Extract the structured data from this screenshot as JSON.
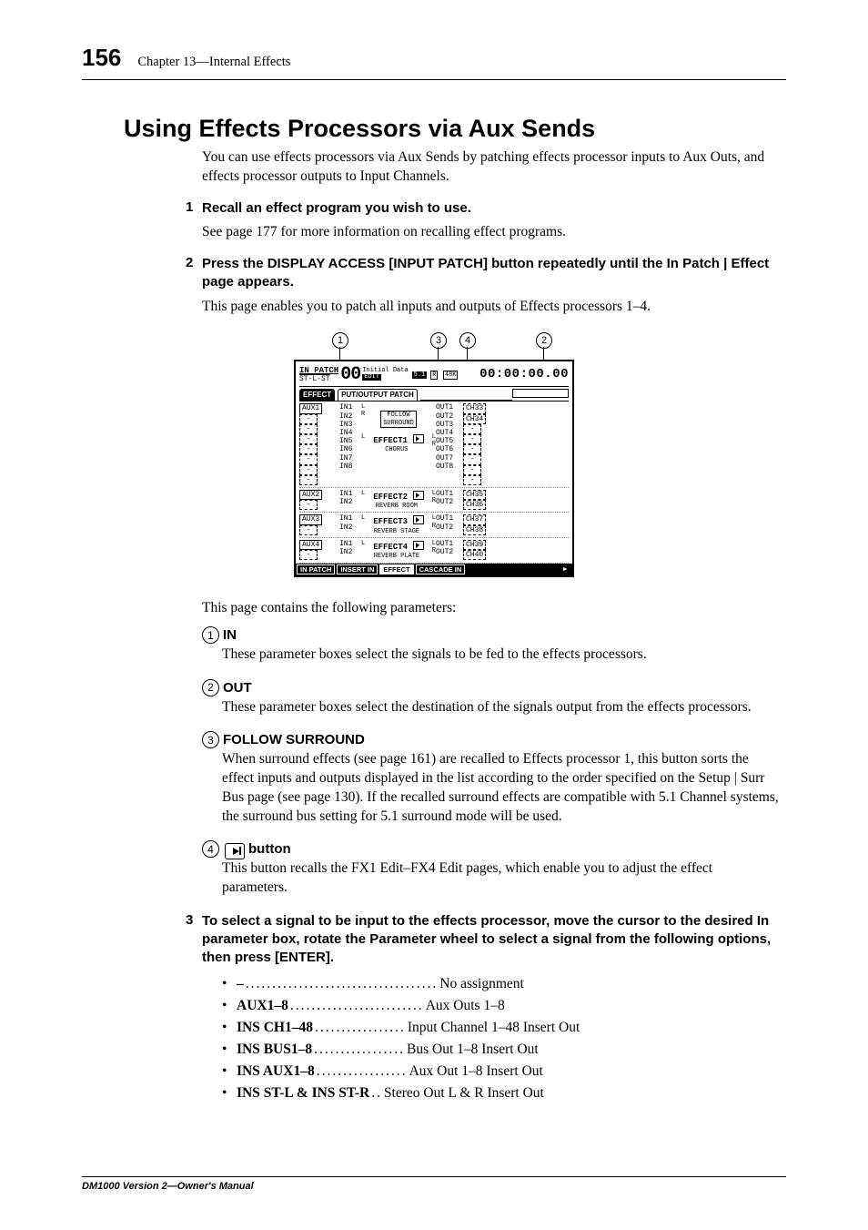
{
  "page_number": "156",
  "chapter_label": "Chapter 13—Internal Effects",
  "section_title": "Using Effects Processors via Aux Sends",
  "intro": "You can use effects processors via Aux Sends by patching effects processor inputs to Aux Outs, and effects processor outputs to Input Channels.",
  "steps": [
    {
      "num": "1",
      "head": "Recall an effect program you wish to use.",
      "body": "See page 177 for more information on recalling effect programs."
    },
    {
      "num": "2",
      "head": "Press the DISPLAY ACCESS [INPUT PATCH] button repeatedly until the In Patch | Effect page appears.",
      "body": "This page enables you to patch all inputs and outputs of Effects processors 1–4."
    }
  ],
  "post_figure_intro": "This page contains the following parameters:",
  "params": [
    {
      "num": "1",
      "label": "IN",
      "desc": "These parameter boxes select the signals to be fed to the effects processors."
    },
    {
      "num": "2",
      "label": "OUT",
      "desc": "These parameter boxes select the destination of the signals output from the effects processors."
    },
    {
      "num": "3",
      "label": "FOLLOW SURROUND",
      "desc": "When surround effects (see page 161) are recalled to Effects processor 1, this button sorts the effect inputs and outputs displayed in the list according to the order specified on the Setup | Surr Bus page (see page 130). If the recalled surround effects are compatible with 5.1 Channel systems, the surround bus setting for 5.1 surround mode will be used."
    },
    {
      "num": "4",
      "label_icon": true,
      "label": "button",
      "desc": "This button recalls the FX1 Edit–FX4 Edit pages, which enable you to adjust the effect parameters."
    }
  ],
  "step3": {
    "num": "3",
    "head": "To select a signal to be input to the effects processor, move the cursor to the desired In parameter box, rotate the Parameter wheel to select a signal from the following options, then press [ENTER]."
  },
  "bullets": [
    {
      "key": "–",
      "dots": "....................................",
      "val": "No assignment"
    },
    {
      "key": "AUX1–8",
      "dots": ".........................",
      "val": "Aux Outs 1–8"
    },
    {
      "key": "INS CH1–48",
      "dots": ".................",
      "val": "Input Channel 1–48 Insert Out"
    },
    {
      "key": "INS BUS1–8",
      "dots": ".................",
      "val": "Bus Out 1–8 Insert Out"
    },
    {
      "key": "INS AUX1–8",
      "dots": ".................",
      "val": "Aux Out 1–8 Insert Out"
    },
    {
      "key": "INS ST-L & INS ST-R",
      "dots": "..",
      "val": "Stereo Out L & R Insert Out"
    }
  ],
  "figure": {
    "callouts": [
      "1",
      "3",
      "4",
      "2"
    ],
    "header": {
      "title": "IN PATCH",
      "sub": "ST-L-ST",
      "scene": "00",
      "mode": "Initial Data",
      "edit": "EDIT",
      "fmt": "5.1",
      "sr": "48K",
      "time": "00:00:00.00"
    },
    "tab1": "EFFECT",
    "tab2": "PUT/OUTPUT PATCH",
    "effects": [
      {
        "aux": "AUX1",
        "ins": [
          "IN1",
          "IN2",
          "IN3",
          "IN4",
          "IN5",
          "IN6",
          "IN7",
          "IN8"
        ],
        "name": "EFFECT1",
        "type": "CHORUS",
        "follow": "FOLLOW SURROUND",
        "outs": [
          "OUT1",
          "OUT2",
          "OUT3",
          "OUT4",
          "OUT5",
          "OUT6",
          "OUT7",
          "OUT8"
        ],
        "chs": [
          "CH33",
          "CH34",
          "-",
          "-",
          "-",
          "-",
          "-",
          "-"
        ]
      },
      {
        "aux": "AUX2",
        "ins": [
          "IN1",
          "IN2"
        ],
        "name": "EFFECT2",
        "type": "REVERB ROOM",
        "outs": [
          "OUT1",
          "OUT2"
        ],
        "chs": [
          "CH35",
          "CH36"
        ]
      },
      {
        "aux": "AUX3",
        "ins": [
          "IN1",
          "IN2"
        ],
        "name": "EFFECT3",
        "type": "REVERB STAGE",
        "outs": [
          "OUT1",
          "OUT2"
        ],
        "chs": [
          "CH37",
          "CH38"
        ]
      },
      {
        "aux": "AUX4",
        "ins": [
          "IN1",
          "IN2"
        ],
        "name": "EFFECT4",
        "type": "REVERB PLATE",
        "outs": [
          "OUT1",
          "OUT2"
        ],
        "chs": [
          "CH39",
          "CH40"
        ]
      }
    ],
    "bottom_tabs": [
      "IN PATCH",
      "INSERT IN",
      "EFFECT",
      "CASCADE IN"
    ]
  },
  "footer": "DM1000 Version 2—Owner's Manual"
}
